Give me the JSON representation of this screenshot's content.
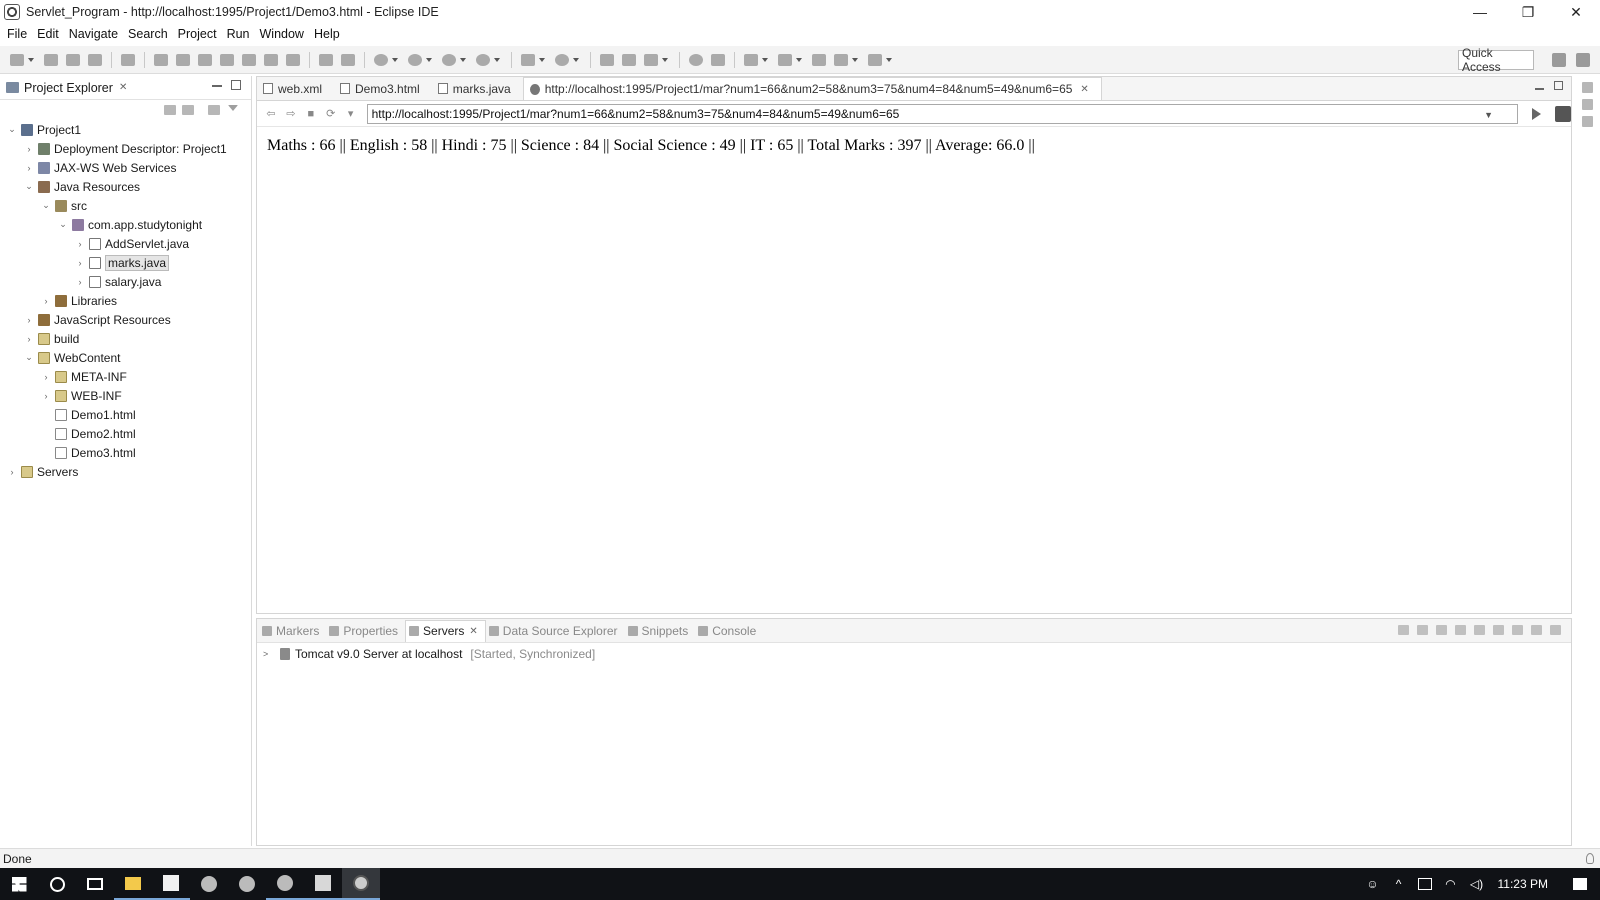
{
  "window": {
    "title": "Servlet_Program - http://localhost:1995/Project1/Demo3.html - Eclipse IDE",
    "controls": [
      "—",
      "❐",
      "✕"
    ]
  },
  "menu": [
    "File",
    "Edit",
    "Navigate",
    "Search",
    "Project",
    "Run",
    "Window",
    "Help"
  ],
  "toolbar": {
    "quick_access": "Quick Access"
  },
  "explorer": {
    "title": "Project Explorer",
    "tree": [
      {
        "label": "Project1",
        "depth": 0,
        "chev": "open",
        "icon": "project"
      },
      {
        "label": "Deployment Descriptor: Project1",
        "depth": 1,
        "chev": "closed",
        "icon": "desc"
      },
      {
        "label": "JAX-WS Web Services",
        "depth": 1,
        "chev": "closed",
        "icon": "ws"
      },
      {
        "label": "Java Resources",
        "depth": 1,
        "chev": "open",
        "icon": "jres"
      },
      {
        "label": "src",
        "depth": 2,
        "chev": "open",
        "icon": "src"
      },
      {
        "label": "com.app.studytonight",
        "depth": 3,
        "chev": "open",
        "icon": "pkg"
      },
      {
        "label": "AddServlet.java",
        "depth": 4,
        "chev": "closed",
        "icon": "java"
      },
      {
        "label": "marks.java",
        "depth": 4,
        "chev": "closed",
        "icon": "java",
        "selected": true
      },
      {
        "label": "salary.java",
        "depth": 4,
        "chev": "closed",
        "icon": "java"
      },
      {
        "label": "Libraries",
        "depth": 2,
        "chev": "closed",
        "icon": "lib"
      },
      {
        "label": "JavaScript Resources",
        "depth": 1,
        "chev": "closed",
        "icon": "lib"
      },
      {
        "label": "build",
        "depth": 1,
        "chev": "closed",
        "icon": "folder"
      },
      {
        "label": "WebContent",
        "depth": 1,
        "chev": "open",
        "icon": "folder"
      },
      {
        "label": "META-INF",
        "depth": 2,
        "chev": "closed",
        "icon": "folder"
      },
      {
        "label": "WEB-INF",
        "depth": 2,
        "chev": "closed",
        "icon": "folder"
      },
      {
        "label": "Demo1.html",
        "depth": 2,
        "chev": "none",
        "icon": "file"
      },
      {
        "label": "Demo2.html",
        "depth": 2,
        "chev": "none",
        "icon": "file"
      },
      {
        "label": "Demo3.html",
        "depth": 2,
        "chev": "none",
        "icon": "file"
      },
      {
        "label": "Servers",
        "depth": 0,
        "chev": "closed",
        "icon": "folder"
      }
    ]
  },
  "editor": {
    "tabs": [
      {
        "label": "web.xml",
        "icon": "file"
      },
      {
        "label": "Demo3.html",
        "icon": "file"
      },
      {
        "label": "marks.java",
        "icon": "file"
      },
      {
        "label": "http://localhost:1995/Project1/mar?num1=66&num2=58&num3=75&num4=84&num5=49&num6=65",
        "icon": "globe",
        "active": true
      }
    ],
    "url": "http://localhost:1995/Project1/mar?num1=66&num2=58&num3=75&num4=84&num5=49&num6=65",
    "page_text": "Maths : 66 || English : 58 || Hindi : 75 || Science : 84 || Social Science : 49 || IT : 65 || Total Marks : 397 || Average: 66.0 ||"
  },
  "panel": {
    "tabs": [
      {
        "label": "Markers"
      },
      {
        "label": "Properties"
      },
      {
        "label": "Servers",
        "active": true
      },
      {
        "label": "Data Source Explorer"
      },
      {
        "label": "Snippets"
      },
      {
        "label": "Console"
      }
    ],
    "server": {
      "name": "Tomcat v9.0 Server at localhost",
      "status": "[Started, Synchronized]"
    }
  },
  "status": "Done",
  "taskbar": {
    "clock": "11:23 PM"
  }
}
